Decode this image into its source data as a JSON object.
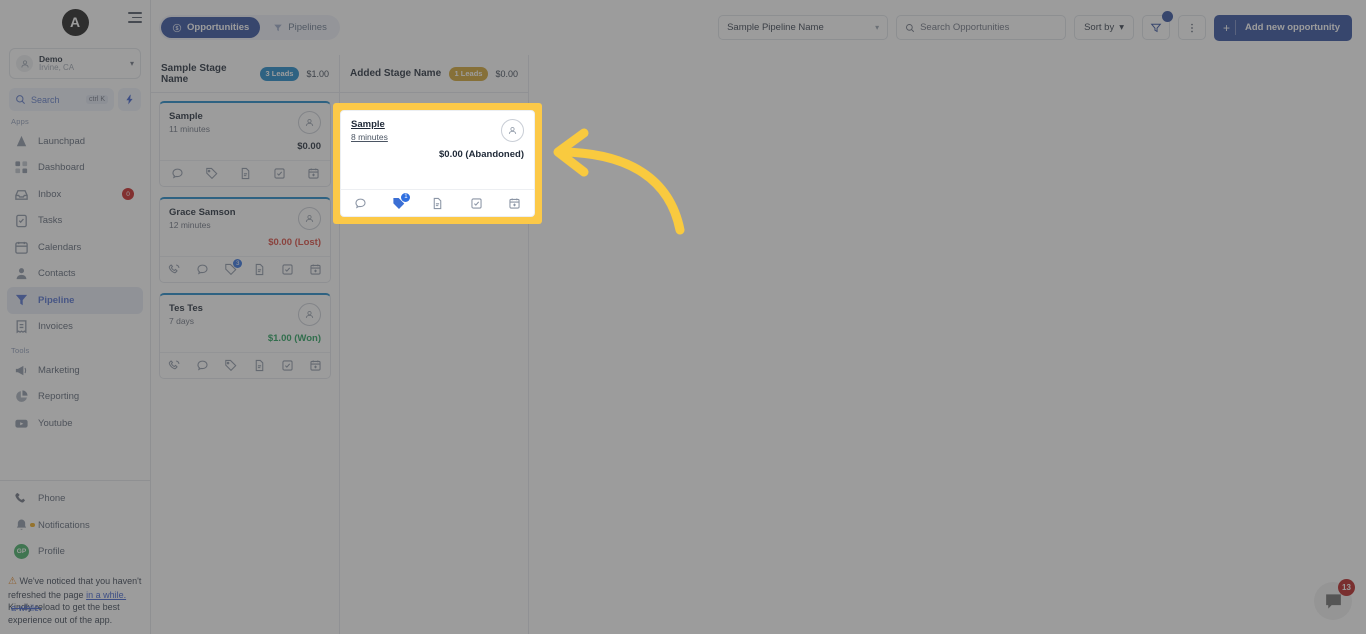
{
  "sidebar": {
    "logo_letter": "A",
    "workspace": {
      "name": "Demo",
      "location": "Irvine, CA"
    },
    "search": {
      "placeholder": "Search",
      "shortcut": "ctrl K"
    },
    "section_apps": "Apps",
    "section_tools": "Tools",
    "apps": [
      {
        "label": "Launchpad",
        "icon": "launchpad-icon",
        "badge": ""
      },
      {
        "label": "Dashboard",
        "icon": "dashboard-icon",
        "badge": ""
      },
      {
        "label": "Inbox",
        "icon": "inbox-icon",
        "badge": "0"
      },
      {
        "label": "Tasks",
        "icon": "tasks-icon",
        "badge": ""
      },
      {
        "label": "Calendars",
        "icon": "calendar-icon",
        "badge": ""
      },
      {
        "label": "Contacts",
        "icon": "contacts-icon",
        "badge": ""
      },
      {
        "label": "Pipeline",
        "icon": "pipeline-icon",
        "badge": ""
      },
      {
        "label": "Invoices",
        "icon": "invoices-icon",
        "badge": ""
      }
    ],
    "tools": [
      {
        "label": "Marketing",
        "icon": "megaphone-icon"
      },
      {
        "label": "Reporting",
        "icon": "pie-chart-icon"
      },
      {
        "label": "Youtube",
        "icon": "youtube-icon"
      }
    ],
    "bottom": [
      {
        "label": "Phone",
        "icon": "phone-icon"
      },
      {
        "label": "Notifications",
        "icon": "bell-icon"
      },
      {
        "label": "Profile",
        "icon": "avatar-icon",
        "initials": "GP"
      }
    ],
    "warning": {
      "line1": "We've noticed that you",
      "line2": "haven't refreshed the page",
      "line3_link": "in a while.",
      "line3_strike": "a while.",
      "line3_rest": "Kindly reload to",
      "line4": "get the best experience out",
      "line5": "of the app."
    }
  },
  "topbar": {
    "tabs": [
      {
        "label": "Opportunities",
        "icon": "dollar-circle-icon",
        "active": true
      },
      {
        "label": "Pipelines",
        "icon": "funnel-icon",
        "active": false
      }
    ],
    "pipeline_select": "Sample Pipeline Name",
    "search_placeholder": "Search Opportunities",
    "sort_label": "Sort by",
    "filter_icon": "funnel-filter-icon",
    "more_icon": "kebab-menu-icon",
    "add_button": "Add new opportunity"
  },
  "board": {
    "columns": [
      {
        "title": "Sample Stage Name",
        "leads": "3 Leads",
        "leads_color": "blue",
        "amount": "$1.00",
        "cards": [
          {
            "name": "Sample",
            "time": "11 minutes",
            "amount": "$0.00",
            "state": "",
            "icons": [
              "chat-icon",
              "tag-icon",
              "document-icon",
              "task-check-icon",
              "calendar-add-icon"
            ],
            "icon_badges": [
              "",
              "",
              "",
              "",
              ""
            ]
          },
          {
            "name": "Grace Samson",
            "time": "12 minutes",
            "amount": "$0.00 (Lost)",
            "state": "lost",
            "icons": [
              "phone-call-icon",
              "chat-icon",
              "tag-icon",
              "document-icon",
              "task-check-icon",
              "calendar-add-icon"
            ],
            "icon_badges": [
              "",
              "",
              "3",
              "",
              "",
              ""
            ]
          },
          {
            "name": "Tes Tes",
            "time": "7 days",
            "amount": "$1.00 (Won)",
            "state": "won",
            "icons": [
              "phone-call-icon",
              "chat-icon",
              "tag-icon",
              "document-icon",
              "task-check-icon",
              "calendar-add-icon"
            ],
            "icon_badges": [
              "",
              "",
              "",
              "",
              "",
              ""
            ]
          }
        ]
      },
      {
        "title": "Added Stage Name",
        "leads": "1 Leads",
        "leads_color": "gold",
        "amount": "$0.00",
        "cards": []
      }
    ]
  },
  "highlight": {
    "name": "Sample",
    "time": "8 minutes",
    "amount": "$0.00 (Abandoned)",
    "icons": [
      "chat-icon",
      "tag-icon",
      "document-icon",
      "task-check-icon",
      "calendar-add-icon"
    ],
    "icon_badges": [
      "",
      "1",
      "",
      "",
      ""
    ],
    "border_color": "#fcc948",
    "annotation": "curved-arrow-left"
  },
  "chat_widget": {
    "badge": "13",
    "icon": "chat-bubble-icon"
  }
}
